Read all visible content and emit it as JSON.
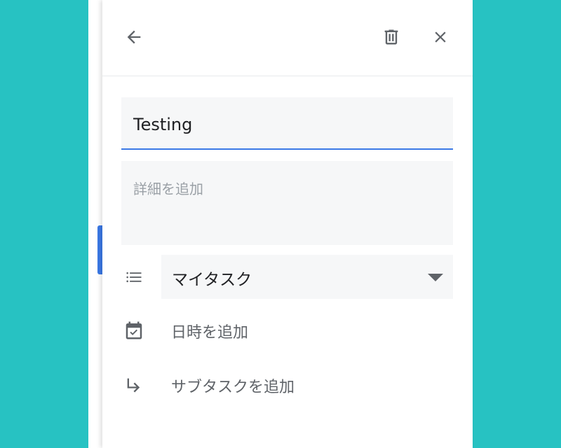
{
  "header": {
    "back_icon": "arrow-back-icon",
    "delete_icon": "trash-icon",
    "close_icon": "close-icon"
  },
  "task": {
    "title_value": "Testing",
    "details_placeholder": "詳細を追加",
    "details_value": ""
  },
  "list": {
    "icon": "list-icon",
    "selected": "マイタスク"
  },
  "actions": {
    "add_date_label": "日時を追加",
    "add_date_icon": "calendar-check-icon",
    "add_subtask_label": "サブタスクを追加",
    "add_subtask_icon": "subdirectory-arrow-icon"
  },
  "colors": {
    "background": "#27c2c2",
    "accent": "#3b79e6",
    "field_bg": "#f6f7f8"
  }
}
